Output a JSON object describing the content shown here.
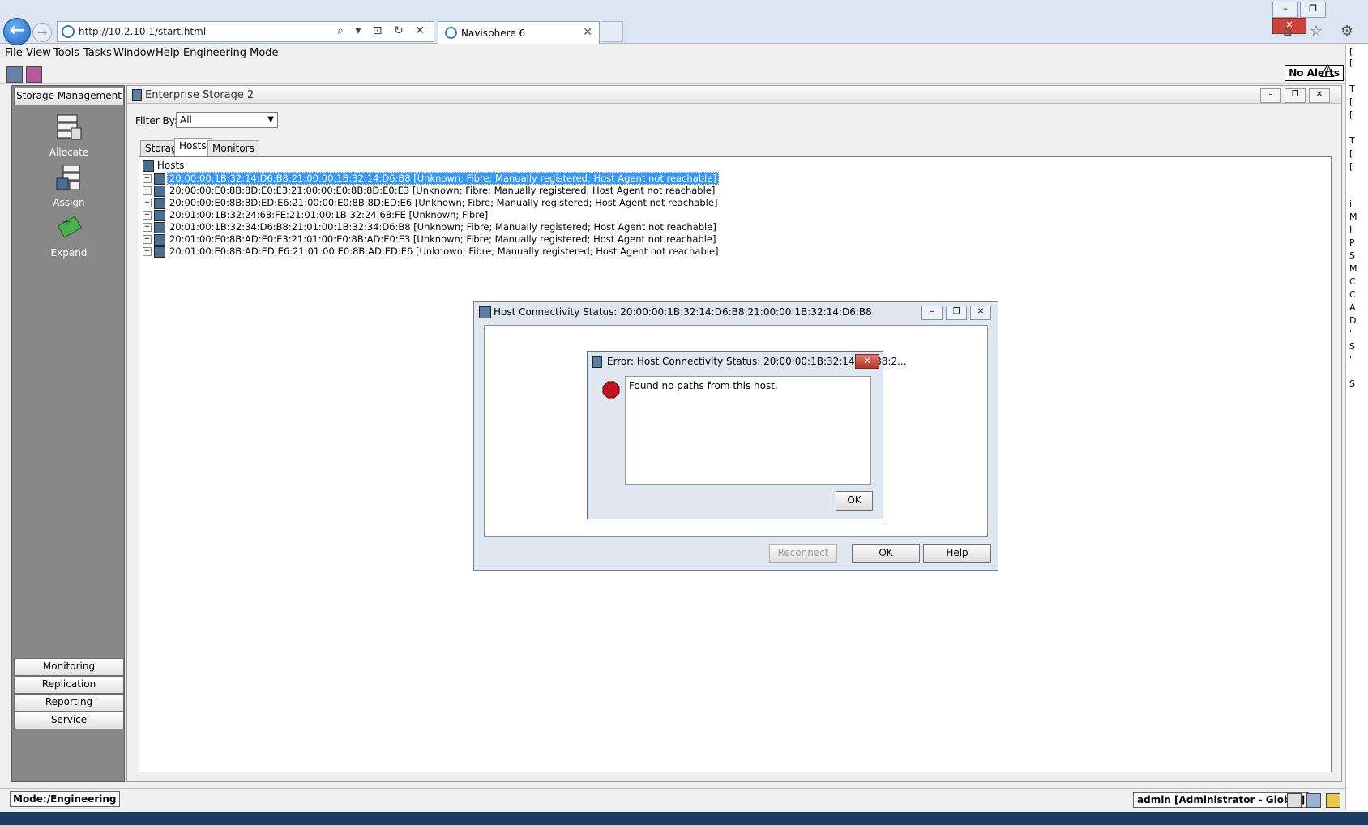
{
  "browser": {
    "url": "http://10.2.10.1/start.html",
    "tab_title": "Navisphere 6",
    "tab_close": "✕",
    "address_tools": "⌕ ▾ ⊡ ↻ ✕",
    "window_controls": [
      "–",
      "❐",
      "✕"
    ],
    "chrome_icons": "⌂ ☆ ⚙"
  },
  "menu": [
    "File",
    "View",
    "Tools",
    "Tasks",
    "Window",
    "Help",
    "Engineering Mode"
  ],
  "alerts": {
    "label": "No Alerts"
  },
  "leftnav": {
    "top_button": "Storage Management",
    "tools": [
      "Allocate",
      "Assign",
      "Expand"
    ],
    "bottom_buttons": [
      "Monitoring",
      "Replication",
      "Reporting",
      "Service"
    ]
  },
  "main": {
    "title": "Enterprise Storage 2",
    "filter_label": "Filter By:",
    "filter_value": "All",
    "tabs": [
      "Storage",
      "Hosts",
      "Monitors"
    ],
    "active_tab": "Hosts",
    "tree_root": "Hosts",
    "hosts": [
      "20:00:00:1B:32:14:D6:B8:21:00:00:1B:32:14:D6:B8 [Unknown; Fibre; Manually registered; Host Agent not reachable]",
      "20:00:00:E0:8B:8D:E0:E3:21:00:00:E0:8B:8D:E0:E3 [Unknown; Fibre; Manually registered; Host Agent not reachable]",
      "20:00:00:E0:8B:8D:ED:E6:21:00:00:E0:8B:8D:ED:E6 [Unknown; Fibre; Manually registered; Host Agent not reachable]",
      "20:01:00:1B:32:24:68:FE:21:01:00:1B:32:24:68:FE [Unknown; Fibre]",
      "20:01:00:1B:32:34:D6:B8:21:01:00:1B:32:34:D6:B8 [Unknown; Fibre; Manually registered; Host Agent not reachable]",
      "20:01:00:E0:8B:AD:E0:E3:21:01:00:E0:8B:AD:E0:E3 [Unknown; Fibre; Manually registered; Host Agent not reachable]",
      "20:01:00:E0:8B:AD:ED:E6:21:01:00:E0:8B:AD:ED:E6 [Unknown; Fibre; Manually registered; Host Agent not reachable]"
    ]
  },
  "dialog_host": {
    "title": "Host Connectivity Status: 20:00:00:1B:32:14:D6:B8:21:00:00:1B:32:14:D6:B8",
    "buttons": {
      "reconnect": "Reconnect",
      "ok": "OK",
      "help": "Help"
    }
  },
  "dialog_error": {
    "title": "Error: Host Connectivity Status: 20:00:00:1B:32:14:D6:B8:2...",
    "message": "Found no paths from this host.",
    "ok": "OK"
  },
  "status": {
    "mode": "Mode:/Engineering",
    "user": "admin [Administrator - Global]"
  },
  "right_strip": [
    "[",
    "[",
    "T",
    "[",
    "[",
    "T",
    "[",
    "[",
    "i",
    "M",
    "I",
    "P",
    "S",
    "M",
    "C",
    "C",
    "A",
    "D",
    "'",
    "S",
    "'",
    "S"
  ],
  "colors": {
    "selection": "#3399ff",
    "nav_bg": "#888888",
    "error_red": "#c0141e"
  }
}
